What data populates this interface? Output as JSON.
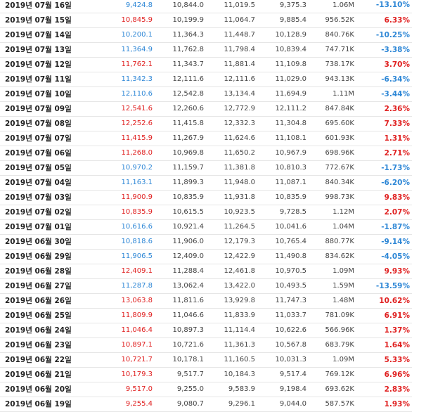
{
  "colors": {
    "up": "#e02020",
    "down": "#2e87d6"
  },
  "rows": [
    {
      "date": "2019년 07월 16일",
      "close": "9,424.8",
      "open": "10,844.0",
      "high": "11,019.5",
      "low": "9,375.3",
      "volume": "1.06M",
      "change": "-13.10%",
      "dir": "down"
    },
    {
      "date": "2019년 07월 15일",
      "close": "10,845.9",
      "open": "10,199.9",
      "high": "11,064.7",
      "low": "9,885.4",
      "volume": "956.52K",
      "change": "6.33%",
      "dir": "up"
    },
    {
      "date": "2019년 07월 14일",
      "close": "10,200.1",
      "open": "11,364.3",
      "high": "11,448.7",
      "low": "10,128.9",
      "volume": "840.76K",
      "change": "-10.25%",
      "dir": "down"
    },
    {
      "date": "2019년 07월 13일",
      "close": "11,364.9",
      "open": "11,762.8",
      "high": "11,798.4",
      "low": "10,839.4",
      "volume": "747.71K",
      "change": "-3.38%",
      "dir": "down"
    },
    {
      "date": "2019년 07월 12일",
      "close": "11,762.1",
      "open": "11,343.7",
      "high": "11,881.4",
      "low": "11,109.8",
      "volume": "738.17K",
      "change": "3.70%",
      "dir": "up"
    },
    {
      "date": "2019년 07월 11일",
      "close": "11,342.3",
      "open": "12,111.6",
      "high": "12,111.6",
      "low": "11,029.0",
      "volume": "943.13K",
      "change": "-6.34%",
      "dir": "down"
    },
    {
      "date": "2019년 07월 10일",
      "close": "12,110.6",
      "open": "12,542.8",
      "high": "13,134.4",
      "low": "11,694.9",
      "volume": "1.11M",
      "change": "-3.44%",
      "dir": "down"
    },
    {
      "date": "2019년 07월 09일",
      "close": "12,541.6",
      "open": "12,260.6",
      "high": "12,772.9",
      "low": "12,111.2",
      "volume": "847.84K",
      "change": "2.36%",
      "dir": "up"
    },
    {
      "date": "2019년 07월 08일",
      "close": "12,252.6",
      "open": "11,415.8",
      "high": "12,332.3",
      "low": "11,304.8",
      "volume": "695.60K",
      "change": "7.33%",
      "dir": "up"
    },
    {
      "date": "2019년 07월 07일",
      "close": "11,415.9",
      "open": "11,267.9",
      "high": "11,624.6",
      "low": "11,108.1",
      "volume": "601.93K",
      "change": "1.31%",
      "dir": "up"
    },
    {
      "date": "2019년 07월 06일",
      "close": "11,268.0",
      "open": "10,969.8",
      "high": "11,650.2",
      "low": "10,967.9",
      "volume": "698.96K",
      "change": "2.71%",
      "dir": "up"
    },
    {
      "date": "2019년 07월 05일",
      "close": "10,970.2",
      "open": "11,159.7",
      "high": "11,381.8",
      "low": "10,810.3",
      "volume": "772.67K",
      "change": "-1.73%",
      "dir": "down"
    },
    {
      "date": "2019년 07월 04일",
      "close": "11,163.1",
      "open": "11,899.3",
      "high": "11,948.0",
      "low": "11,087.1",
      "volume": "840.34K",
      "change": "-6.20%",
      "dir": "down"
    },
    {
      "date": "2019년 07월 03일",
      "close": "11,900.9",
      "open": "10,835.9",
      "high": "11,931.8",
      "low": "10,835.9",
      "volume": "998.73K",
      "change": "9.83%",
      "dir": "up"
    },
    {
      "date": "2019년 07월 02일",
      "close": "10,835.9",
      "open": "10,615.5",
      "high": "10,923.5",
      "low": "9,728.5",
      "volume": "1.12M",
      "change": "2.07%",
      "dir": "up"
    },
    {
      "date": "2019년 07월 01일",
      "close": "10,616.6",
      "open": "10,921.4",
      "high": "11,264.5",
      "low": "10,041.6",
      "volume": "1.04M",
      "change": "-1.87%",
      "dir": "down"
    },
    {
      "date": "2019년 06월 30일",
      "close": "10,818.6",
      "open": "11,906.0",
      "high": "12,179.3",
      "low": "10,765.4",
      "volume": "880.77K",
      "change": "-9.14%",
      "dir": "down"
    },
    {
      "date": "2019년 06월 29일",
      "close": "11,906.5",
      "open": "12,409.0",
      "high": "12,422.9",
      "low": "11,490.8",
      "volume": "834.62K",
      "change": "-4.05%",
      "dir": "down"
    },
    {
      "date": "2019년 06월 28일",
      "close": "12,409.1",
      "open": "11,288.4",
      "high": "12,461.8",
      "low": "10,970.5",
      "volume": "1.09M",
      "change": "9.93%",
      "dir": "up"
    },
    {
      "date": "2019년 06월 27일",
      "close": "11,287.8",
      "open": "13,062.4",
      "high": "13,422.0",
      "low": "10,493.5",
      "volume": "1.59M",
      "change": "-13.59%",
      "dir": "down"
    },
    {
      "date": "2019년 06월 26일",
      "close": "13,063.8",
      "open": "11,811.6",
      "high": "13,929.8",
      "low": "11,747.3",
      "volume": "1.48M",
      "change": "10.62%",
      "dir": "up"
    },
    {
      "date": "2019년 06월 25일",
      "close": "11,809.9",
      "open": "11,046.6",
      "high": "11,833.9",
      "low": "11,033.7",
      "volume": "781.09K",
      "change": "6.91%",
      "dir": "up"
    },
    {
      "date": "2019년 06월 24일",
      "close": "11,046.4",
      "open": "10,897.3",
      "high": "11,114.4",
      "low": "10,622.6",
      "volume": "566.96K",
      "change": "1.37%",
      "dir": "up"
    },
    {
      "date": "2019년 06월 23일",
      "close": "10,897.1",
      "open": "10,721.6",
      "high": "11,361.3",
      "low": "10,567.8",
      "volume": "683.79K",
      "change": "1.64%",
      "dir": "up"
    },
    {
      "date": "2019년 06월 22일",
      "close": "10,721.7",
      "open": "10,178.1",
      "high": "11,160.5",
      "low": "10,031.3",
      "volume": "1.09M",
      "change": "5.33%",
      "dir": "up"
    },
    {
      "date": "2019년 06월 21일",
      "close": "10,179.3",
      "open": "9,517.7",
      "high": "10,184.3",
      "low": "9,517.4",
      "volume": "769.12K",
      "change": "6.96%",
      "dir": "up"
    },
    {
      "date": "2019년 06월 20일",
      "close": "9,517.0",
      "open": "9,255.0",
      "high": "9,583.9",
      "low": "9,198.4",
      "volume": "693.62K",
      "change": "2.83%",
      "dir": "up"
    },
    {
      "date": "2019년 06월 19일",
      "close": "9,255.4",
      "open": "9,080.7",
      "high": "9,296.1",
      "low": "9,044.0",
      "volume": "587.57K",
      "change": "1.93%",
      "dir": "up"
    }
  ]
}
